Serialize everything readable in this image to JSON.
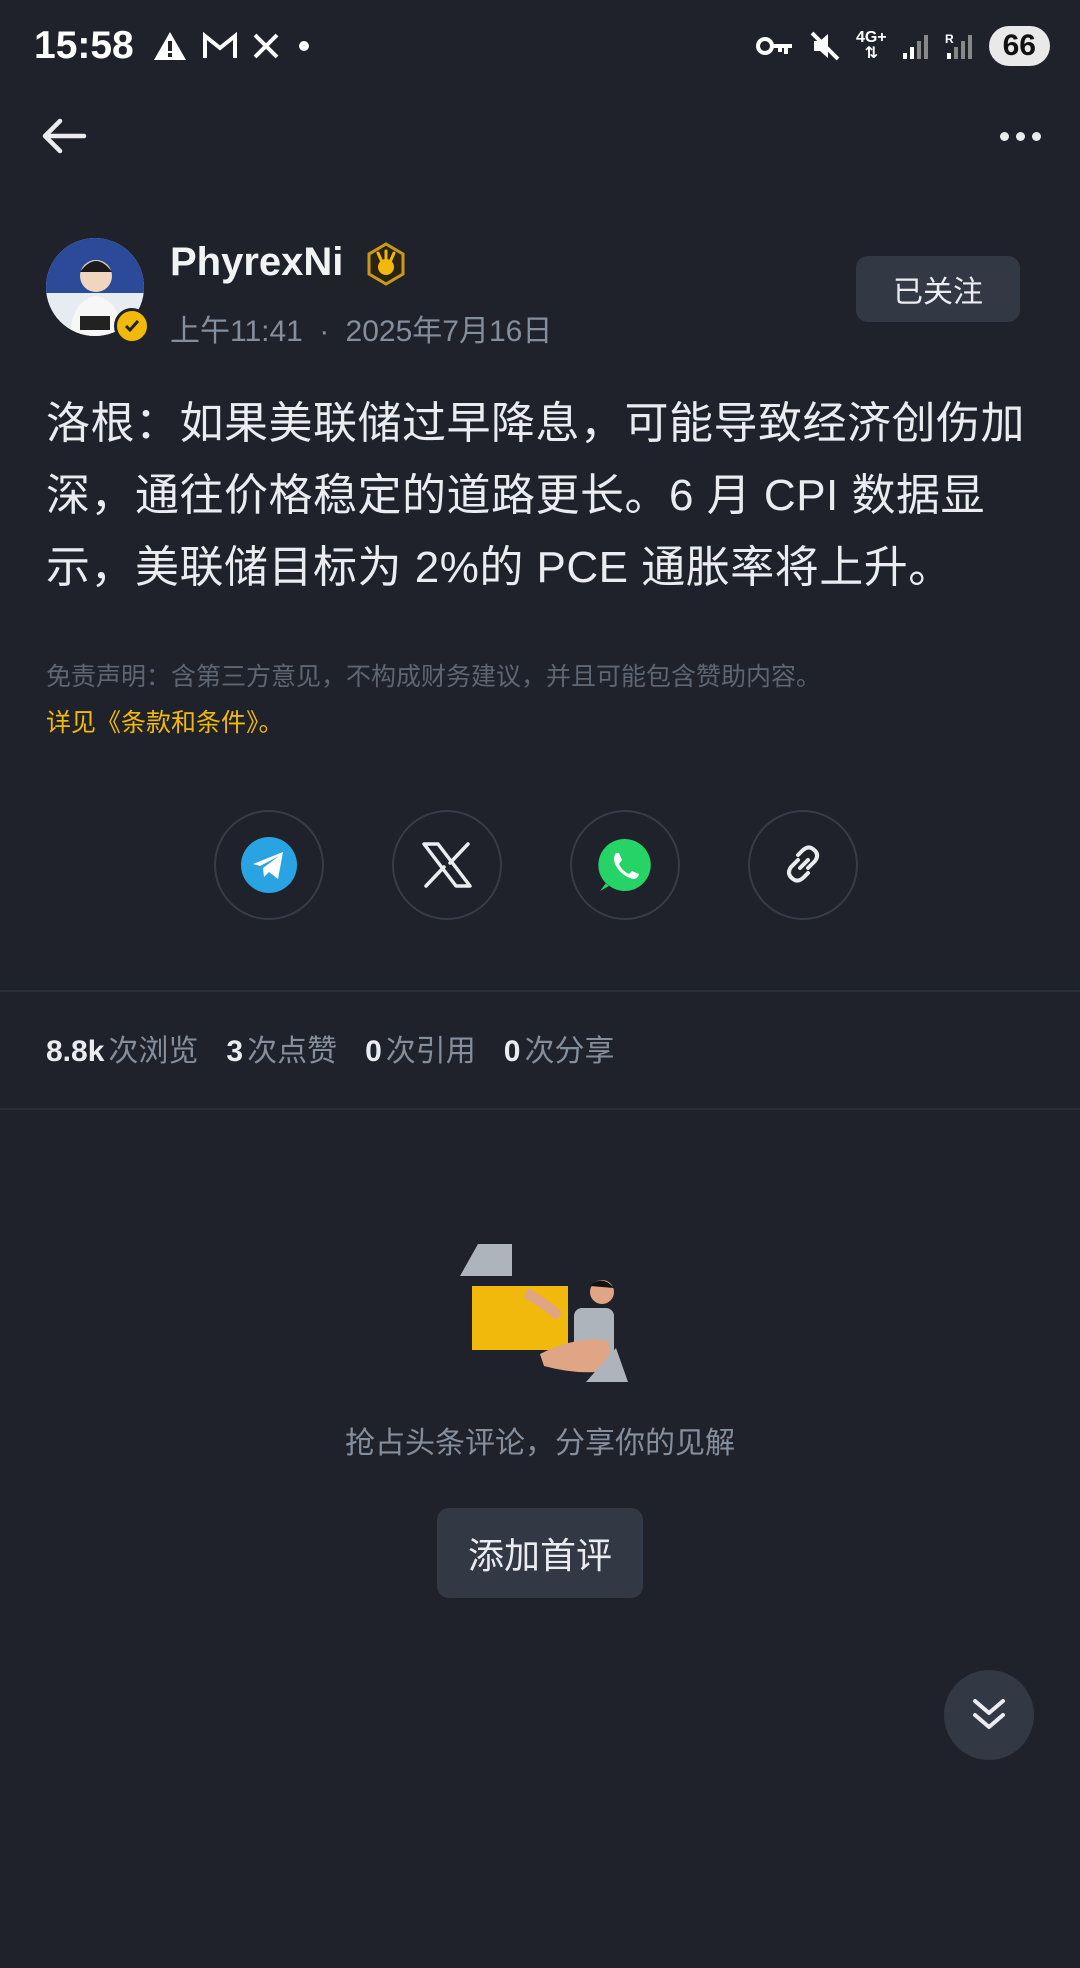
{
  "status_bar": {
    "time": "15:58",
    "battery": "66",
    "network": "4G+"
  },
  "author": {
    "name": "PhyrexNi",
    "time": "上午11:41",
    "date": "2025年7月16日",
    "follow_label": "已关注"
  },
  "post": {
    "body": "洛根：如果美联储过早降息，可能导致经济创伤加深，通往价格稳定的道路更长。6 月 CPI 数据显示，美联储目标为 2%的 PCE 通胀率将上升。",
    "disclaimer": "免责声明：含第三方意见，不构成财务建议，并且可能包含赞助内容。",
    "terms_link": "详见《条款和条件》。"
  },
  "share_icons": [
    "telegram-icon",
    "x-icon",
    "whatsapp-icon",
    "link-icon"
  ],
  "stats": [
    {
      "value": "8.8k",
      "label": "次浏览"
    },
    {
      "value": "3",
      "label": "次点赞"
    },
    {
      "value": "0",
      "label": "次引用"
    },
    {
      "value": "0",
      "label": "次分享"
    }
  ],
  "comments": {
    "empty_text": "抢占头条评论，分享你的见解",
    "add_label": "添加首评"
  },
  "colors": {
    "background": "#1f222b",
    "accent": "#f0b90b",
    "button": "#333845"
  }
}
